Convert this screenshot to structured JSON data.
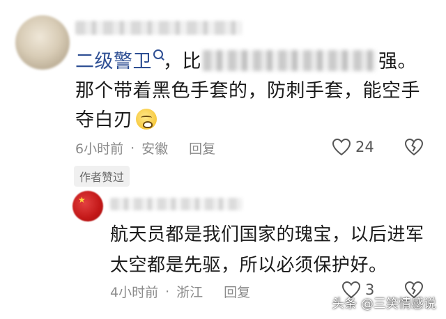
{
  "comment_1": {
    "mention": "二级警卫",
    "text_before_blur": "，比",
    "text_after_blur": "强。那个带着黑色手套的，防刺手套，能空手夺白刃",
    "time": "6小时前",
    "location": "安徽",
    "reply_label": "回复",
    "like_count": "24",
    "icons": {
      "like": "heart-outline-icon",
      "dislike": "broken-heart-icon",
      "emoji": "crying-face-emoji"
    }
  },
  "author_liked_badge": "作者赞过",
  "comment_2": {
    "text": "航天员都是我们国家的瑰宝，以后进军太空都是先驱，所以必须保护好。",
    "time": "4小时前",
    "location": "浙江",
    "reply_label": "回复",
    "like_count": "3",
    "icons": {
      "like": "heart-outline-icon",
      "dislike": "broken-heart-icon"
    }
  },
  "watermark": "头条 @三笑情感说",
  "colors": {
    "mention": "#2d4e93",
    "meta": "#8a8a8a",
    "text": "#1b1b1b"
  }
}
